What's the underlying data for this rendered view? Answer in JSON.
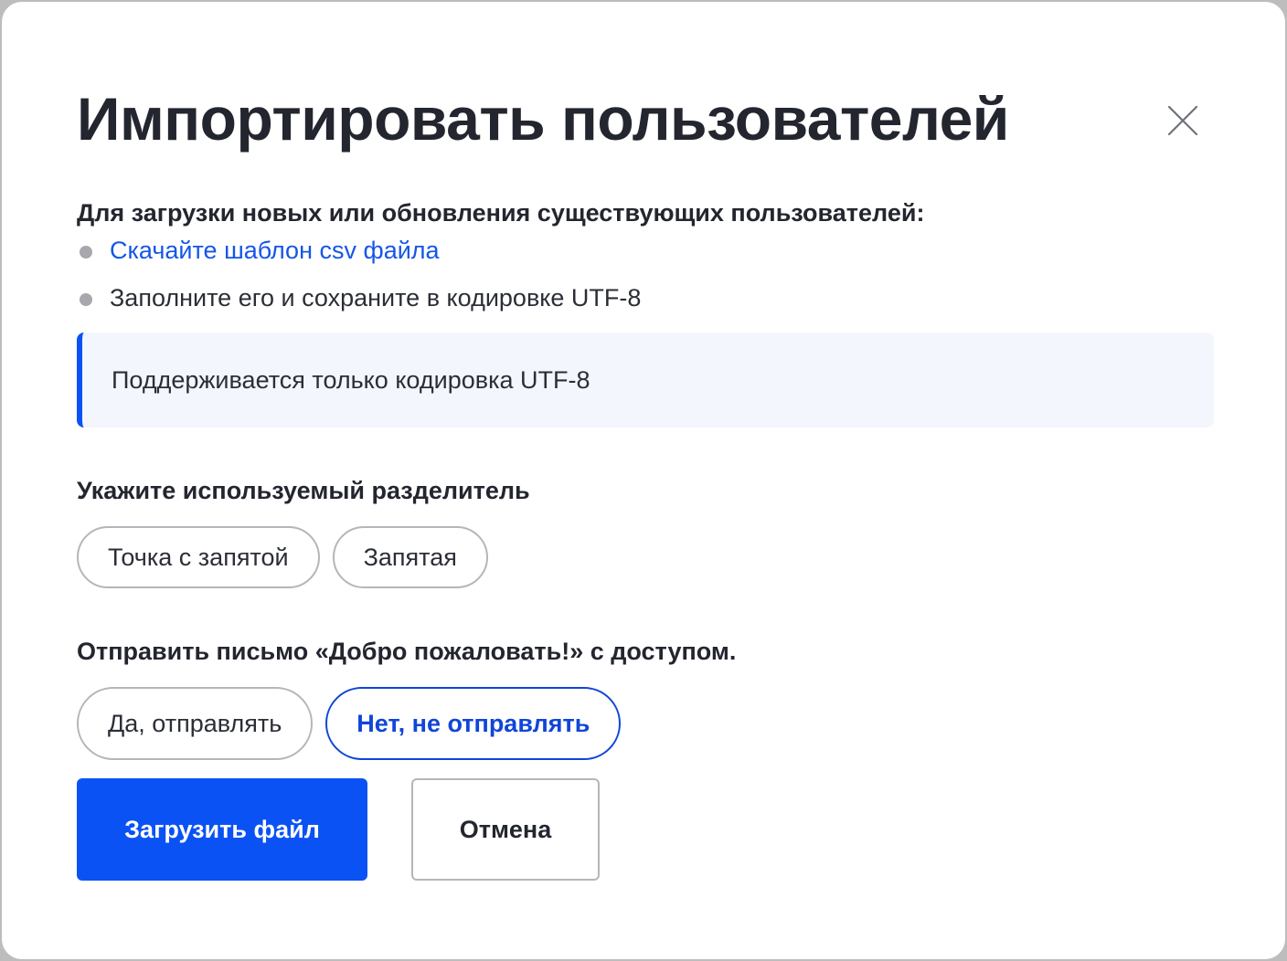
{
  "dialog": {
    "title": "Импортировать пользователей",
    "intro": "Для загрузки новых или обновления существующих пользователей:",
    "steps": {
      "download_link": "Скачайте шаблон csv файла",
      "fill_and_save": "Заполните его и сохраните в кодировке UTF-8"
    },
    "notice": "Поддерживается только кодировка UTF-8",
    "separator": {
      "label": "Укажите используемый разделитель",
      "options": [
        "Точка с запятой",
        "Запятая"
      ]
    },
    "welcome_email": {
      "label": "Отправить письмо «Добро пожаловать!» с доступом.",
      "options": [
        "Да, отправлять",
        "Нет, не отправлять"
      ],
      "selected": "Нет, не отправлять"
    },
    "actions": {
      "upload": "Загрузить файл",
      "cancel": "Отмена"
    }
  },
  "icons": {
    "close": "close-icon",
    "bullet": "bullet-dot"
  },
  "colors": {
    "accent": "#0b52f5",
    "link": "#1556e8",
    "selected_option": "#1046d8",
    "text": "#23262f",
    "notice_bg": "#f3f6fd",
    "border": "#b4b6bb"
  }
}
